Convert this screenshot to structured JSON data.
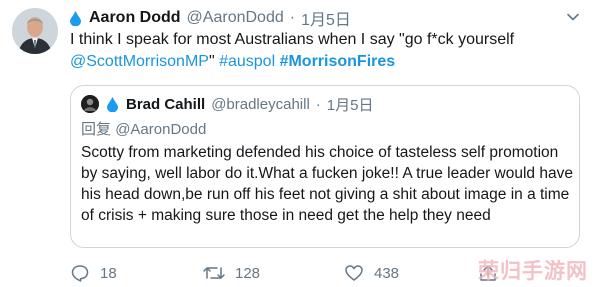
{
  "tweet": {
    "author_name": "Aaron Dodd",
    "author_handle": "@AaronDodd",
    "separator": "·",
    "date": "1月5日",
    "text_line1": "I think I speak for most Australians when I say \"go f*ck yourself",
    "mention": "@ScottMorrisonMP",
    "closing_quote": "\"",
    "hashtag1": "#auspol",
    "hashtag2": "#MorrisonFires"
  },
  "quoted": {
    "author_name": "Brad Cahill",
    "author_handle": "@bradleycahill",
    "separator": "·",
    "date": "1月5日",
    "reply_prefix": "回复",
    "reply_handle": "@AaronDodd",
    "body": "Scotty from marketing defended his choice of tasteless self promotion by saying, well labor do it.What a fucken joke!! A true leader would have his head down,be run off his feet not giving a shit about image in a time of crisis + making sure those in need get the help they need"
  },
  "actions": {
    "replies": "18",
    "retweets": "128",
    "likes": "438"
  },
  "watermark": "荣归手游网",
  "colors": {
    "link": "#1b95e0",
    "muted": "#657786",
    "border": "#ccd6dd",
    "text": "#14171a"
  }
}
